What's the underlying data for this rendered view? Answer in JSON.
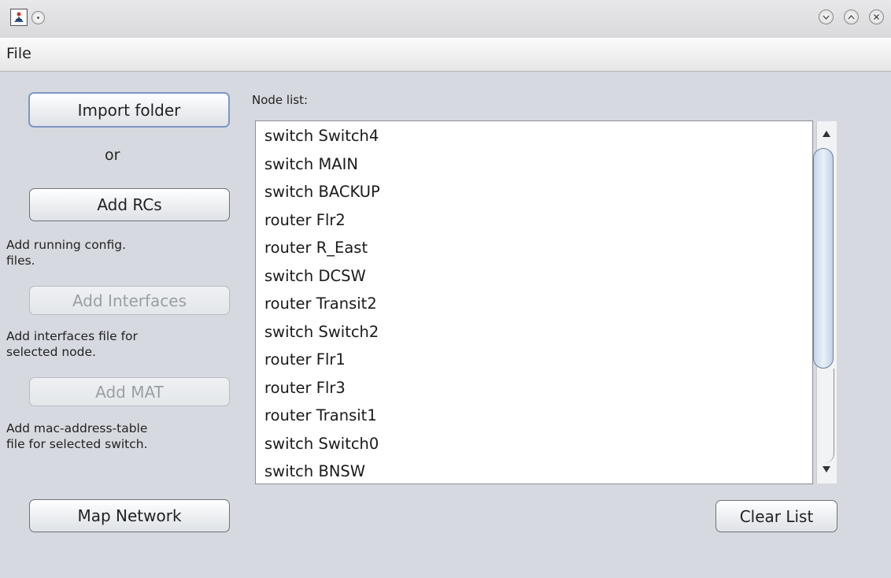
{
  "menubar": {
    "file_label": "File"
  },
  "sidebar": {
    "import_folder_label": "Import folder",
    "or_label": "or",
    "add_rcs_label": "Add RCs",
    "add_rcs_desc_line1": "Add running config.",
    "add_rcs_desc_line2": "files.",
    "add_interfaces_label": "Add Interfaces",
    "add_interfaces_desc_line1": "Add interfaces file for",
    "add_interfaces_desc_line2": "selected node.",
    "add_mat_label": "Add MAT",
    "add_mat_desc_line1": "Add mac-address-table",
    "add_mat_desc_line2": "file for selected switch.",
    "map_network_label": "Map Network"
  },
  "node_list": {
    "label": "Node list:",
    "items": [
      "switch Switch4",
      "switch MAIN",
      "switch BACKUP",
      "router Flr2",
      "router R_East",
      "switch DCSW",
      "router Transit2",
      "switch Switch2",
      "router Flr1",
      "router Flr3",
      "router Transit1",
      "switch Switch0",
      "switch BNSW"
    ],
    "clear_label": "Clear List"
  },
  "icons": {
    "app": "network-app-icon",
    "window_menu": "window-menu-icon",
    "minimize": "minimize-icon",
    "maximize": "maximize-icon",
    "close": "close-icon",
    "scroll_up": "scroll-up-arrow-icon",
    "scroll_down": "scroll-down-arrow-icon"
  }
}
